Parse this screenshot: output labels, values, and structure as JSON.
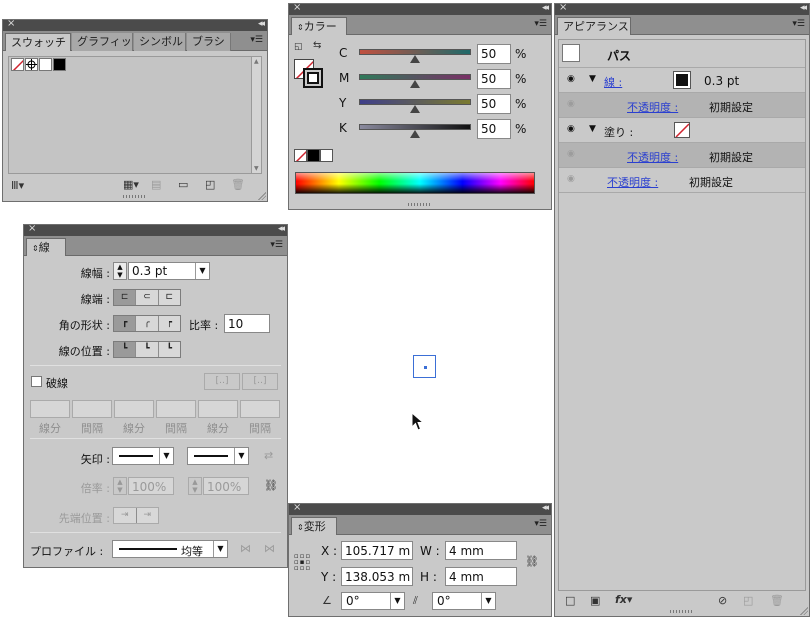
{
  "swatches_panel": {
    "tabs": [
      "スウォッチ",
      "グラフィッ",
      "シンボル",
      "ブラシ"
    ]
  },
  "color_panel": {
    "tab": "カラー",
    "channels": [
      {
        "label": "C",
        "value": "50",
        "unit": "%",
        "fraction": 0.5,
        "gradient_start": "#c0503f",
        "gradient_end": "#1f6a6a"
      },
      {
        "label": "M",
        "value": "50",
        "unit": "%",
        "fraction": 0.5,
        "gradient_start": "#2f7a5a",
        "gradient_end": "#7a2f66"
      },
      {
        "label": "Y",
        "value": "50",
        "unit": "%",
        "fraction": 0.5,
        "gradient_start": "#3f3f8a",
        "gradient_end": "#7a7a2f"
      },
      {
        "label": "K",
        "value": "50",
        "unit": "%",
        "fraction": 0.5,
        "gradient_start": "#8a8a9e",
        "gradient_end": "#111111"
      }
    ]
  },
  "appearance_panel": {
    "tab": "アピアランス",
    "object_label": "パス",
    "stroke_label": "線 :",
    "stroke_value": "0.3 pt",
    "stroke_opacity_label": "不透明度 :",
    "stroke_opacity_value": "初期設定",
    "fill_label": "塗り :",
    "fill_opacity_label": "不透明度 :",
    "fill_opacity_value": "初期設定",
    "opacity_label": "不透明度 :",
    "opacity_value": "初期設定",
    "fx_label": "fx"
  },
  "stroke_panel": {
    "tab": "線",
    "weight_label": "線幅 :",
    "weight_value": "0.3 pt",
    "cap_label": "線端 :",
    "corner_label": "角の形状 :",
    "limit_label": "比率 :",
    "limit_value": "10",
    "align_label": "線の位置 :",
    "dashed_label": "破線",
    "dash_labels": [
      "線分",
      "間隔",
      "線分",
      "間隔",
      "線分",
      "間隔"
    ],
    "arrow_label": "矢印 :",
    "scale_label": "倍率 :",
    "scale_start": "100%",
    "scale_end": "100%",
    "tip_label": "先端位置 :",
    "profile_label": "プロファイル :",
    "profile_value": "均等"
  },
  "transform_panel": {
    "tab": "変形",
    "x_label": "X :",
    "x_value": "105.717 m",
    "y_label": "Y :",
    "y_value": "138.053 m",
    "w_label": "W :",
    "w_value": "4 mm",
    "h_label": "H :",
    "h_value": "4 mm",
    "angle_value": "0°",
    "shear_value": "0°"
  }
}
